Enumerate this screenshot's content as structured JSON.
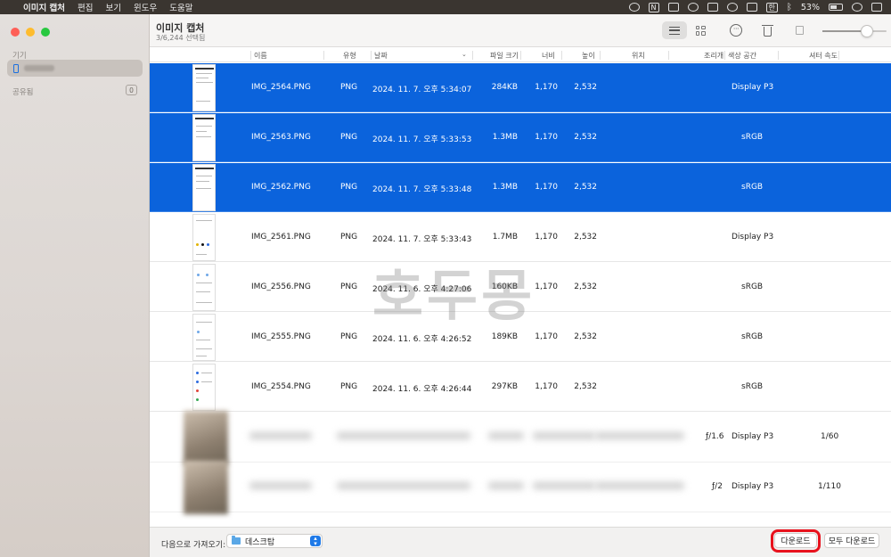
{
  "menubar": {
    "apple": "",
    "app_name": "이미지 캡처",
    "menus": [
      "편집",
      "보기",
      "윈도우",
      "도움말"
    ],
    "notion_icon": "N",
    "input_lang": "한",
    "battery": "53%"
  },
  "sidebar": {
    "section_devices": "기기",
    "section_shared": "공유됨",
    "shared_count": "0"
  },
  "toolbar": {
    "title": "이미지 캡처",
    "subtitle": "3/6,244 선택됨",
    "more_glyph": "···"
  },
  "columns": {
    "name": "이름",
    "type": "유형",
    "date": "날짜",
    "file_size": "파일 크기",
    "width": "너비",
    "height": "높이",
    "location": "위치",
    "aperture": "조리개",
    "color_space": "색상 공간",
    "shutter_speed": "셔터 속도",
    "sort_indicator": "⌄"
  },
  "rows": [
    {
      "name": "IMG_2564.PNG",
      "type": "PNG",
      "date": "2024. 11. 7. 오후 5:34:07",
      "size": "284KB",
      "width": "1,170",
      "height": "2,532",
      "color_space": "Display P3",
      "selected": true
    },
    {
      "name": "IMG_2563.PNG",
      "type": "PNG",
      "date": "2024. 11. 7. 오후 5:33:53",
      "size": "1.3MB",
      "width": "1,170",
      "height": "2,532",
      "color_space": "sRGB",
      "selected": true
    },
    {
      "name": "IMG_2562.PNG",
      "type": "PNG",
      "date": "2024. 11. 7. 오후 5:33:48",
      "size": "1.3MB",
      "width": "1,170",
      "height": "2,532",
      "color_space": "sRGB",
      "selected": true
    },
    {
      "name": "IMG_2561.PNG",
      "type": "PNG",
      "date": "2024. 11. 7. 오후 5:33:43",
      "size": "1.7MB",
      "width": "1,170",
      "height": "2,532",
      "color_space": "Display P3",
      "selected": false
    },
    {
      "name": "IMG_2556.PNG",
      "type": "PNG",
      "date": "2024. 11. 6. 오후 4:27:06",
      "size": "160KB",
      "width": "1,170",
      "height": "2,532",
      "color_space": "sRGB",
      "selected": false
    },
    {
      "name": "IMG_2555.PNG",
      "type": "PNG",
      "date": "2024. 11. 6. 오후 4:26:52",
      "size": "189KB",
      "width": "1,170",
      "height": "2,532",
      "color_space": "sRGB",
      "selected": false
    },
    {
      "name": "IMG_2554.PNG",
      "type": "PNG",
      "date": "2024. 11. 6. 오후 4:26:44",
      "size": "297KB",
      "width": "1,170",
      "height": "2,532",
      "color_space": "sRGB",
      "selected": false
    }
  ],
  "blurred_rows": [
    {
      "aperture": "ƒ/1.6",
      "color_space": "Display P3",
      "shutter": "1/60"
    },
    {
      "aperture": "ƒ/2",
      "color_space": "Display P3",
      "shutter": "1/110"
    }
  ],
  "watermark": "호두몽",
  "bottom": {
    "import_label": "다음으로 가져오기:",
    "destination": "데스크탑",
    "download_button": "다운로드",
    "download_all_button": "모두 다운로드"
  },
  "colors": {
    "selection": "#0b63dc",
    "highlight": "#e8121d"
  }
}
